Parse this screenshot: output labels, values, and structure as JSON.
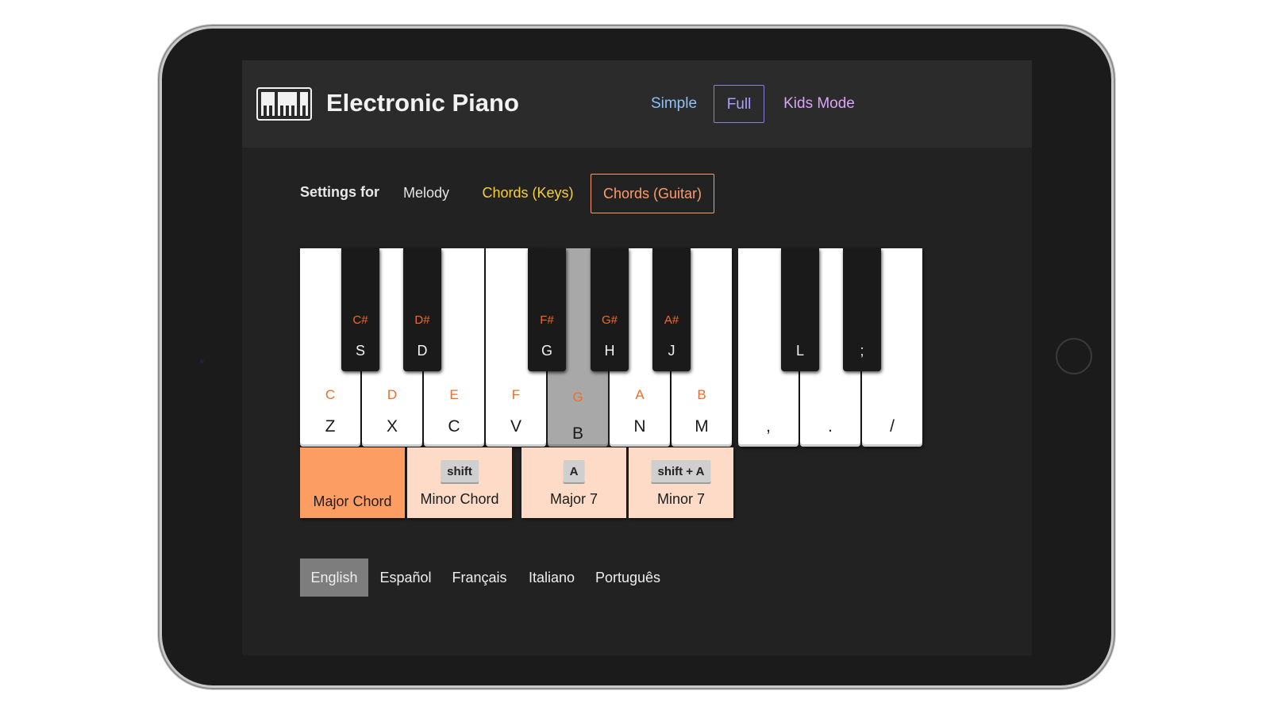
{
  "app": {
    "title": "Electronic Piano",
    "logo_icon": "piano-keys-icon"
  },
  "modes": [
    {
      "label": "Simple",
      "selected": false,
      "color": "#8fc1f5"
    },
    {
      "label": "Full",
      "selected": true,
      "color": "#a9a0ff"
    },
    {
      "label": "Kids Mode",
      "selected": false,
      "color": "#d9a4f7"
    }
  ],
  "settings": {
    "label": "Settings for",
    "tabs": [
      {
        "label": "Melody",
        "selected": false
      },
      {
        "label": "Chords (Keys)",
        "selected": false
      },
      {
        "label": "Chords (Guitar)",
        "selected": true
      }
    ]
  },
  "keyboard": {
    "white_keys": [
      {
        "note": "C",
        "shortcut": "Z",
        "active": false
      },
      {
        "note": "D",
        "shortcut": "X",
        "active": false
      },
      {
        "note": "E",
        "shortcut": "C",
        "active": false
      },
      {
        "note": "F",
        "shortcut": "V",
        "active": false
      },
      {
        "note": "G",
        "shortcut": "B",
        "active": true
      },
      {
        "note": "A",
        "shortcut": "N",
        "active": false
      },
      {
        "note": "B",
        "shortcut": "M",
        "active": false
      },
      {
        "note": "",
        "shortcut": ",",
        "active": false
      },
      {
        "note": "",
        "shortcut": ".",
        "active": false
      },
      {
        "note": "",
        "shortcut": "/",
        "active": false
      }
    ],
    "black_keys": [
      {
        "note": "C#",
        "shortcut": "S"
      },
      {
        "note": "D#",
        "shortcut": "D"
      },
      {
        "note": "F#",
        "shortcut": "G"
      },
      {
        "note": "G#",
        "shortcut": "H"
      },
      {
        "note": "A#",
        "shortcut": "J"
      },
      {
        "note": "",
        "shortcut": "L"
      },
      {
        "note": "",
        "shortcut": ";"
      }
    ]
  },
  "chords": [
    {
      "label": "Major Chord",
      "key": "",
      "active": true
    },
    {
      "label": "Minor Chord",
      "key": "shift",
      "active": false
    },
    {
      "label": "Major 7",
      "key": "A",
      "active": false
    },
    {
      "label": "Minor 7",
      "key": "shift + A",
      "active": false
    }
  ],
  "languages": [
    {
      "label": "English",
      "selected": true
    },
    {
      "label": "Español",
      "selected": false
    },
    {
      "label": "Français",
      "selected": false
    },
    {
      "label": "Italiano",
      "selected": false
    },
    {
      "label": "Português",
      "selected": false
    }
  ],
  "colors": {
    "accent_orange": "#f26a2a",
    "chord_active": "#fc9d63",
    "chord_inactive": "#fddbc6"
  }
}
